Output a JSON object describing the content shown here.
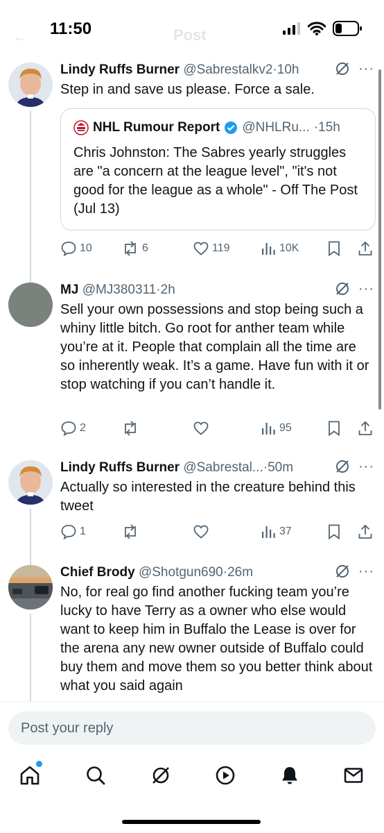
{
  "status_bar": {
    "time": "11:50",
    "header_title": "Post",
    "back_glyph": "←"
  },
  "tweets": [
    {
      "name": "Lindy Ruffs Burner",
      "handle": "@Sabrestalkv2",
      "time": "·10h",
      "text": "Step in and save us please. Force a sale.",
      "quote": {
        "name": "NHL Rumour Report",
        "handle": "@NHLRu...",
        "time": "·15h",
        "text": "Chris Johnston: The Sabres yearly struggles are \"a concern at the league level\", \"it's not good for the league as a whole\" - Off The Post (Jul 13)"
      },
      "stats": {
        "replies": "10",
        "reposts": "6",
        "likes": "119",
        "views": "10K"
      }
    },
    {
      "name": "MJ",
      "handle": "@MJ380311",
      "time": "·2h",
      "text": "Sell your own possessions and stop being such a whiny little bitch. Go root for anther team while you’re at it. People that complain all the time are so inherently weak. It’s a game. Have fun with it or stop watching if you can’t handle it.",
      "stats": {
        "replies": "2",
        "reposts": "",
        "likes": "",
        "views": "95"
      }
    },
    {
      "name": "Lindy Ruffs Burner",
      "handle": "@Sabrestal...",
      "time": "·50m",
      "text": "Actually so interested in the creature behind this tweet",
      "stats": {
        "replies": "1",
        "reposts": "",
        "likes": "",
        "views": "37"
      }
    },
    {
      "name": "Chief Brody",
      "handle": "@Shotgun690",
      "time": "·26m",
      "text": "No, for real go find another fucking team you’re lucky to have Terry as a owner who else would want to keep him in Buffalo the Lease is over for the arena any new owner outside of Buffalo could buy them and move them so you better think about what you said again"
    }
  ],
  "reply_bar": {
    "placeholder": "Post your reply"
  },
  "colors": {
    "accent": "#1d9bf0",
    "text": "#0f1419",
    "muted": "#536471",
    "border": "#cfd9de"
  },
  "icons": [
    "home-icon",
    "search-icon",
    "grok-icon",
    "video-icon",
    "notifications-icon",
    "messages-icon"
  ]
}
